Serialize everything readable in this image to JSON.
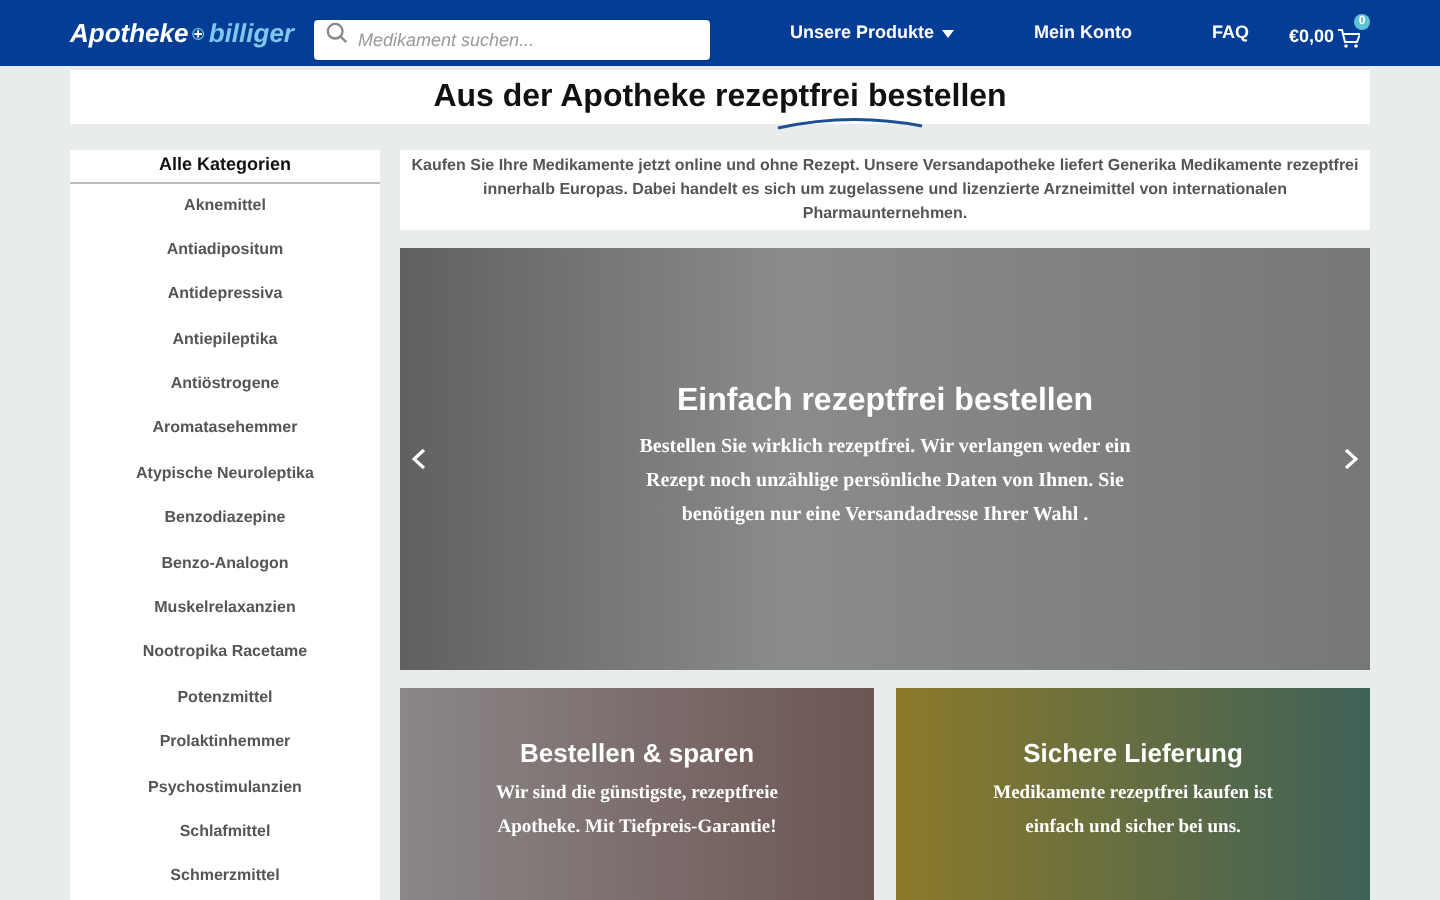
{
  "header": {
    "logo": {
      "left": "Apotheke",
      "right": "billiger"
    },
    "search": {
      "placeholder": "Medikament suchen..."
    },
    "nav": [
      {
        "label": "Unsere Produkte",
        "dropdown": true
      },
      {
        "label": "Mein Konto",
        "dropdown": false
      },
      {
        "label": "FAQ",
        "dropdown": false
      }
    ],
    "cart": {
      "total": "€0,00",
      "count": "0"
    }
  },
  "headline": {
    "before": "Aus der Apotheke",
    "highlight": "rezeptfrei",
    "after": "bestellen"
  },
  "sidebar": {
    "title": "Alle Kategorien",
    "items": [
      "Aknemittel",
      "Antiadipositum",
      "Antidepressiva",
      "Antiepileptika",
      "Antiöstrogene",
      "Aromatasehemmer",
      "Atypische Neuroleptika",
      "Benzodiazepine",
      "Benzo-Analogon",
      "Muskelrelaxanzien",
      "Nootropika Racetame",
      "Potenzmittel",
      "Prolaktinhemmer",
      "Psychostimulanzien",
      "Schlafmittel",
      "Schmerzmittel"
    ]
  },
  "intro": "Kaufen Sie Ihre Medikamente jetzt online und ohne Rezept. Unsere Versandapotheke liefert Generika Medikamente rezeptfrei innerhalb Europas. Dabei handelt es sich um zugelassene und lizenzierte Arzneimittel von internationalen Pharmaunternehmen.",
  "hero": {
    "title": "Einfach rezeptfrei bestellen",
    "text": "Bestellen Sie wirklich rezeptfrei. Wir verlangen weder ein Rezept noch unzählige persönliche Daten von Ihnen. Sie benötigen nur eine Versandadresse Ihrer Wahl ."
  },
  "cards": [
    {
      "title": "Bestellen & sparen",
      "text": "Wir sind die günstigste, rezeptfreie Apotheke. Mit Tiefpreis-Garantie!"
    },
    {
      "title": "Sichere Lieferung",
      "text": "Medikamente rezeptfrei kaufen ist einfach und sicher bei uns."
    }
  ]
}
